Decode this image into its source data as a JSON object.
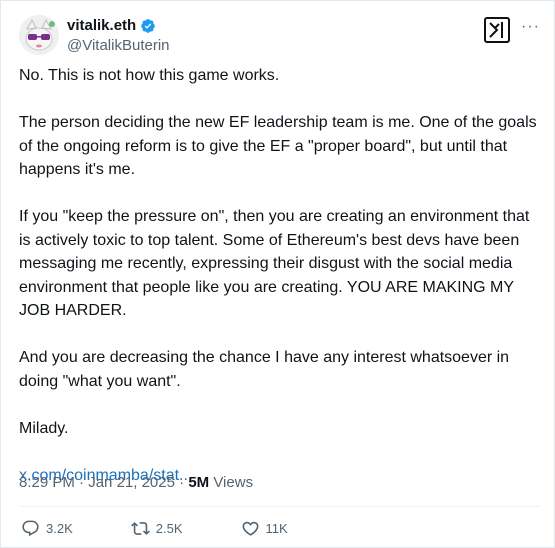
{
  "author": {
    "display_name": "vitalik.eth",
    "handle": "@VitalikButerin",
    "verified": true
  },
  "icons": {
    "verified": "verified-badge-icon",
    "xai": "grok-icon",
    "more": "more-icon",
    "reply": "reply-icon",
    "repost": "repost-icon",
    "like": "like-icon"
  },
  "more_label": "···",
  "tweet": {
    "paragraphs": [
      "No. This is not how this game works.",
      "The person deciding the new EF leadership team is me. One of the goals of the ongoing reform is to give the EF a \"proper board\", but until that happens it's me.",
      "If you \"keep the pressure on\", then you are creating an environment that is actively toxic to top talent. Some of Ethereum's best devs have been messaging me recently, expressing their disgust with the social media environment that people like you are creating. YOU ARE MAKING MY JOB HARDER.",
      "And you are decreasing the chance I have any interest whatsoever in doing \"what you want\".",
      "Milady."
    ],
    "link": "x.com/coinmamba/stat..."
  },
  "meta": {
    "time": "8:29 PM",
    "separator": "·",
    "date": "Jan 21, 2025",
    "views_count": "5M",
    "views_label": "Views"
  },
  "actions": {
    "replies": "3.2K",
    "reposts": "2.5K",
    "likes": "11K"
  },
  "colors": {
    "verified_blue": "#1d9bf0",
    "link_blue": "#1d70b8",
    "secondary_text": "#536471"
  }
}
